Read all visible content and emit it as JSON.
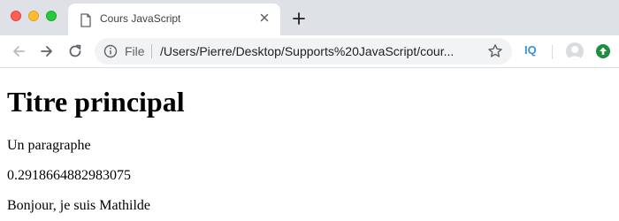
{
  "window": {
    "tab": {
      "title": "Cours JavaScript"
    }
  },
  "toolbar": {
    "scheme_label": "File",
    "url": "/Users/Pierre/Desktop/Supports%20JavaScript/cour...",
    "extension_label": "IQ"
  },
  "page": {
    "heading": "Titre principal",
    "paragraphs": [
      "Un paragraphe",
      "0.2918664882983075",
      "Bonjour, je suis Mathilde"
    ]
  },
  "icons": [
    "document-icon",
    "close-icon",
    "plus-icon",
    "back-arrow-icon",
    "forward-arrow-icon",
    "reload-icon",
    "info-icon",
    "star-icon",
    "avatar-icon",
    "extension-update-icon"
  ],
  "colors": {
    "tabstrip": "#dee1e6",
    "omnibox": "#f1f3f4",
    "extension_green": "#1e8e3e",
    "iq_blue": "#3b8fd6"
  }
}
